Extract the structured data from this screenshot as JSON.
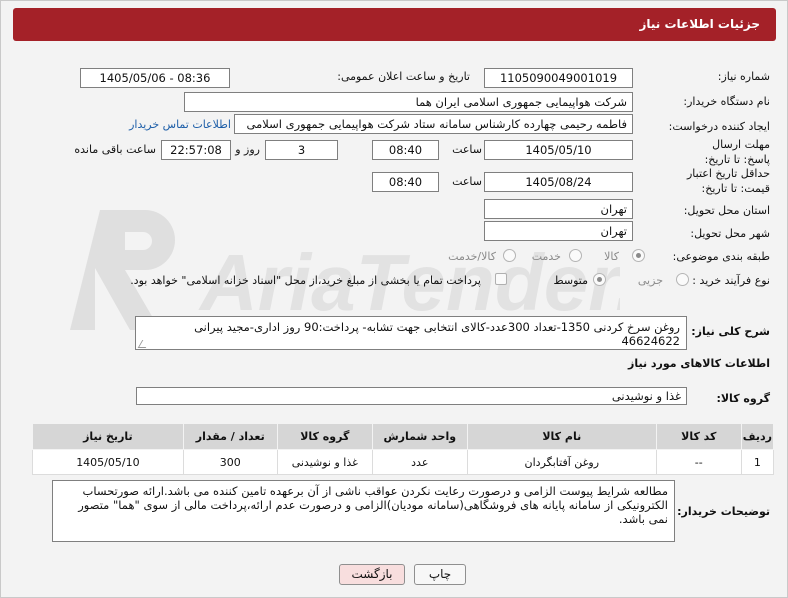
{
  "header": {
    "title": "جزئیات اطلاعات نیاز"
  },
  "labels": {
    "need_number": "شماره نیاز:",
    "announce_datetime": "تاریخ و ساعت اعلان عمومی:",
    "buyer_org": "نام دستگاه خریدار:",
    "creator": "ایجاد کننده درخواست:",
    "deadline": "مهلت ارسال پاسخ: تا تاریخ:",
    "price_validity": "حداقل تاریخ اعتبار قیمت: تا تاریخ:",
    "province": "استان محل تحویل:",
    "city": "شهر محل تحویل:",
    "category": "طبقه بندی موضوعی:",
    "process_type": "نوع فرآیند خرید :",
    "time": "ساعت",
    "day_and": "روز و",
    "remaining": "ساعت باقی مانده",
    "general_desc": "شرح کلی نیاز:",
    "goods_info": "اطلاعات کالاهای مورد نیاز",
    "goods_group": "گروه کالا:",
    "buyer_notes": "توضیحات خریدار:"
  },
  "fields": {
    "need_number": "1105090049001019",
    "announce_datetime": "1405/05/06 - 08:36",
    "buyer_org": "شرکت هواپیمایی جمهوری اسلامی ایران هما",
    "creator": "فاطمه رحیمی چهارده کارشناس سامانه ستاد شرکت هواپیمایی جمهوری اسلامی",
    "contact_link": "اطلاعات تماس خریدار",
    "deadline_date": "1405/05/10",
    "deadline_time": "08:40",
    "deadline_days": "3",
    "deadline_remaining": "22:57:08",
    "validity_date": "1405/08/24",
    "validity_time": "08:40",
    "province": "تهران",
    "city": "تهران",
    "goods_group": "غذا و نوشیدنی"
  },
  "category_options": [
    {
      "label": "کالا",
      "selected": true
    },
    {
      "label": "خدمت",
      "selected": false
    },
    {
      "label": "کالا/خدمت",
      "selected": false
    }
  ],
  "process_options": [
    {
      "label": "جزیی",
      "selected": false
    },
    {
      "label": "متوسط",
      "selected": true
    }
  ],
  "process_note": "پرداخت تمام یا بخشی از مبلغ خرید،از محل \"اسناد خزانه اسلامی\" خواهد بود.",
  "general_description": "روغن سرخ کردنی 1350-تعداد 300عدد-کالای انتخابی جهت تشابه- پرداخت:90 روز اداری-مجید پیرانی 46624622",
  "table": {
    "headers": [
      "ردیف",
      "کد کالا",
      "نام کالا",
      "واحد شمارش",
      "گروه کالا",
      "تعداد / مقدار",
      "تاریخ نیاز"
    ],
    "rows": [
      [
        "1",
        "--",
        "روغن آفتابگردان",
        "عدد",
        "غذا و نوشیدنی",
        "300",
        "1405/05/10"
      ]
    ]
  },
  "buyer_notes": "مطالعه شرایط پیوست الزامی و درصورت رعایت نکردن عواقب ناشی از آن برعهده تامین کننده می باشد.ارائه صورتحساب الکترونیکی از سامانه پایانه های فروشگاهی(سامانه مودیان)الزامی و درصورت عدم ارائه،پرداخت مالی از سوی \"هما\" متصور نمی باشد.",
  "buttons": {
    "print": "چاپ",
    "back": "بازگشت"
  },
  "watermark": "AriaTender.net",
  "colors": {
    "header": "#a42128",
    "link": "#1d5ea8",
    "back_button": "#f8dede"
  }
}
